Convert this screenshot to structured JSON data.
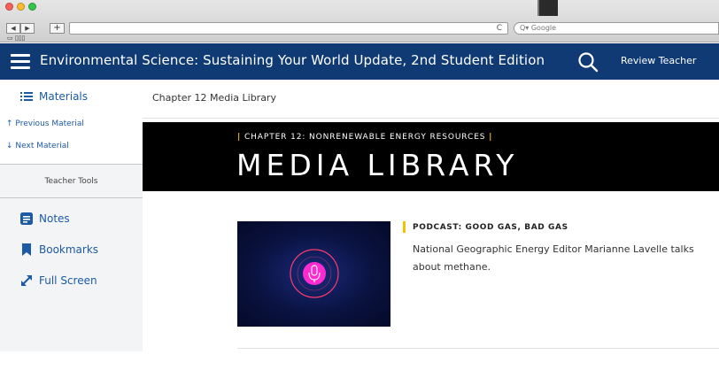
{
  "browser": {
    "search_placeholder": "Q▾ Google",
    "bookmarks_label": "▭ ▯▯▯",
    "back": "◀",
    "forward": "▶",
    "add": "+",
    "reload": "C"
  },
  "header": {
    "title": "Environmental Science: Sustaining Your World Update, 2nd Student Edition",
    "review_label": "Review Teacher"
  },
  "sidebar": {
    "materials_label": "Materials",
    "previous_label": "Previous Material",
    "next_label": "Next Material",
    "tools_label": "Teacher Tools",
    "notes_label": "Notes",
    "bookmarks_label": "Bookmarks",
    "fullscreen_label": "Full Screen"
  },
  "main": {
    "breadcrumb": "Chapter 12 Media Library",
    "chapter_label": "CHAPTER 12: NONRENEWABLE ENERGY RESOURCES",
    "banner_title": "MEDIA LIBRARY",
    "items": [
      {
        "title": "PODCAST: GOOD GAS, BAD GAS",
        "description": "National Geographic Energy Editor Marianne Lavelle talks about methane."
      }
    ]
  },
  "colors": {
    "header_bg": "#0f3a73",
    "link_blue": "#1c5aa6",
    "accent_yellow": "#f2c200",
    "thumbnail_accent": "#ff2bd0"
  },
  "icons": {
    "menu": "hamburger-icon",
    "search": "search-icon",
    "materials": "list-icon",
    "previous": "arrow-up-icon",
    "next": "arrow-down-icon",
    "notes": "notes-icon",
    "bookmarks": "bookmark-icon",
    "fullscreen": "fullscreen-icon",
    "thumbnail": "microphone-icon"
  }
}
